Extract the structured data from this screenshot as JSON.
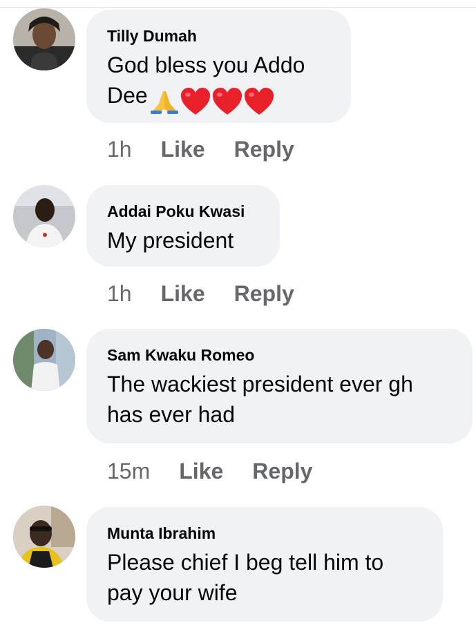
{
  "comments": [
    {
      "author": "Tilly Dumah",
      "text_line1": "God bless you Addo",
      "text_line2": "Dee",
      "emojis": [
        "folded-hands",
        "red-heart",
        "red-heart",
        "red-heart"
      ],
      "time": "1h",
      "like_label": "Like",
      "reply_label": "Reply"
    },
    {
      "author": "Addai Poku Kwasi",
      "text_line1": "My president",
      "time": "1h",
      "like_label": "Like",
      "reply_label": "Reply"
    },
    {
      "author": "Sam Kwaku Romeo",
      "text_line1": "The wackiest president ever gh",
      "text_line2": "has ever had",
      "time": "15m",
      "like_label": "Like",
      "reply_label": "Reply"
    },
    {
      "author": "Munta Ibrahim",
      "text_line1": "Please chief I beg tell him to",
      "text_line2": "pay your wife"
    }
  ],
  "colors": {
    "bubble_bg": "#f0f2f5",
    "meta_text": "#65676b",
    "heart": "#e8202a"
  }
}
